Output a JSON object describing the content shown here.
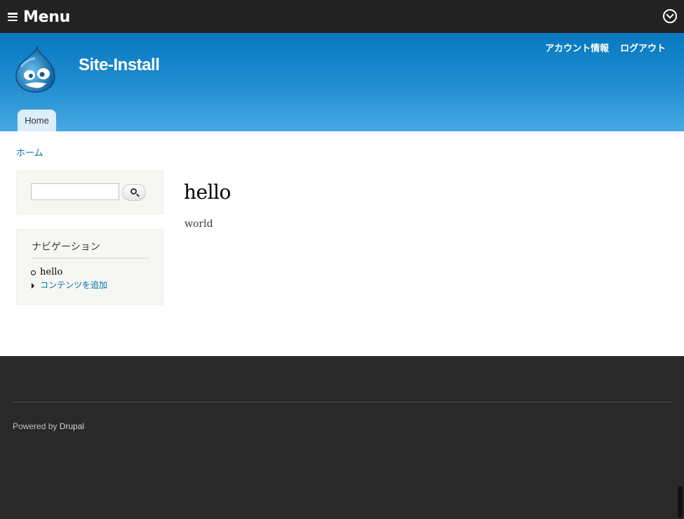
{
  "toolbar": {
    "menu_label": "Menu",
    "menu_icon": "hamburger-icon",
    "toggle_icon": "chevron-down-circle-icon"
  },
  "header": {
    "logo_icon": "drupal-drop-logo",
    "site_name": "Site-Install",
    "secondary_menu": [
      "アカウント情報",
      "ログアウト"
    ],
    "main_menu": [
      "Home"
    ]
  },
  "breadcrumb": [
    "ホーム"
  ],
  "sidebar": {
    "search": {
      "value": "",
      "button_icon": "search-icon"
    },
    "navigation": {
      "title": "ナビゲーション",
      "items": [
        "hello",
        "コンテンツを追加"
      ]
    }
  },
  "content": {
    "title": "hello",
    "body": "world"
  },
  "footer": {
    "powered_prefix": "Powered by",
    "powered_link": "Drupal"
  },
  "colors": {
    "toolbar": "#222222",
    "header_top": "#0779bf",
    "header_bottom": "#48a9e4",
    "link": "#0071b3",
    "footer": "#292929"
  }
}
